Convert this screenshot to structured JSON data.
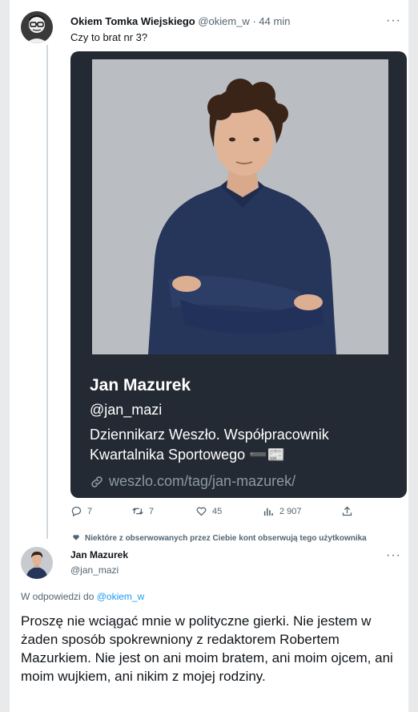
{
  "tweet1": {
    "author_name": "Okiem Tomka Wiejskiego",
    "handle": "@okiem_w",
    "separator": "·",
    "time": "44 min",
    "text": "Czy to brat nr 3?",
    "more_label": "···"
  },
  "card": {
    "name": "Jan Mazurek",
    "handle": "@jan_mazi",
    "bio": "Dziennikarz Weszło. Współpracownik Kwartalnika Sportowego ➖📰",
    "link": "weszlo.com/tag/jan-mazurek/"
  },
  "actions": {
    "replies": "7",
    "retweets": "7",
    "likes": "45",
    "views": "2 907"
  },
  "social_context": "Niektóre z obserwowanych przez Ciebie kont obserwują tego użytkownika",
  "tweet2": {
    "author_name": "Jan Mazurek",
    "handle": "@jan_mazi",
    "more_label": "···",
    "reply_prefix": "W odpowiedzi do",
    "reply_mention": "@okiem_w",
    "text": "Proszę nie wciągać mnie w polityczne gierki. Nie jestem w żaden sposób spokrewniony z redaktorem Robertem Mazurkiem. Nie jest on ani moim bratem, ani moim ojcem, ani moim wujkiem, ani nikim z mojej rodziny."
  },
  "colors": {
    "text_primary": "#0f1419",
    "text_secondary": "#536471",
    "link_blue": "#1d9bf0",
    "card_bg": "#242a33",
    "thread_line": "#cfd9de"
  },
  "icons": [
    "reply-icon",
    "retweet-icon",
    "like-icon",
    "views-icon",
    "share-icon",
    "link-icon",
    "follow-context-icon",
    "more-icon"
  ]
}
